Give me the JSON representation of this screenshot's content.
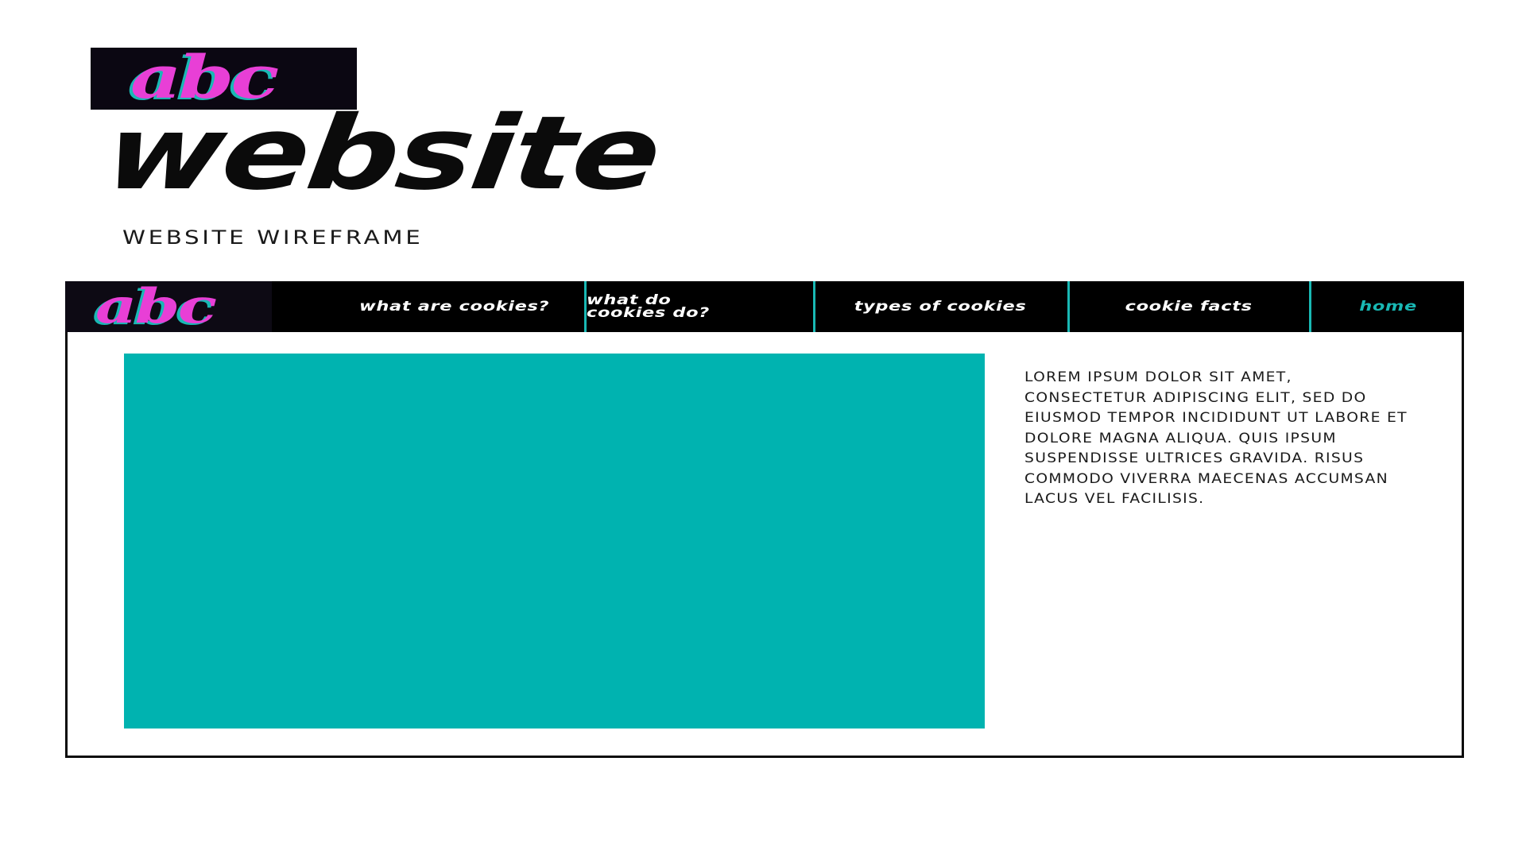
{
  "header": {
    "logo_text": "abc",
    "title": "website",
    "subtitle": "WEBSITE WIREFRAME"
  },
  "wireframe": {
    "nav": {
      "logo_text": "abc",
      "items": [
        {
          "label": "what are cookies?",
          "active": false
        },
        {
          "label": "what do cookies do?",
          "active": false
        },
        {
          "label": "types of cookies",
          "active": false
        },
        {
          "label": "cookie facts",
          "active": false
        },
        {
          "label": "home",
          "active": true
        }
      ]
    },
    "hero": {
      "color": "#00b3b0"
    },
    "body_text": "LOREM IPSUM DOLOR SIT AMET, CONSECTETUR ADIPISCING ELIT, SED DO EIUSMOD TEMPOR INCIDIDUNT UT LABORE ET DOLORE MAGNA ALIQUA. QUIS IPSUM SUSPENDISSE ULTRICES GRAVIDA. RISUS COMMODO VIVERRA MAECENAS ACCUMSAN LACUS VEL FACILISIS."
  },
  "colors": {
    "accent_pink": "#e83fd6",
    "accent_teal": "#19b8b4",
    "dark": "#0b0712"
  }
}
